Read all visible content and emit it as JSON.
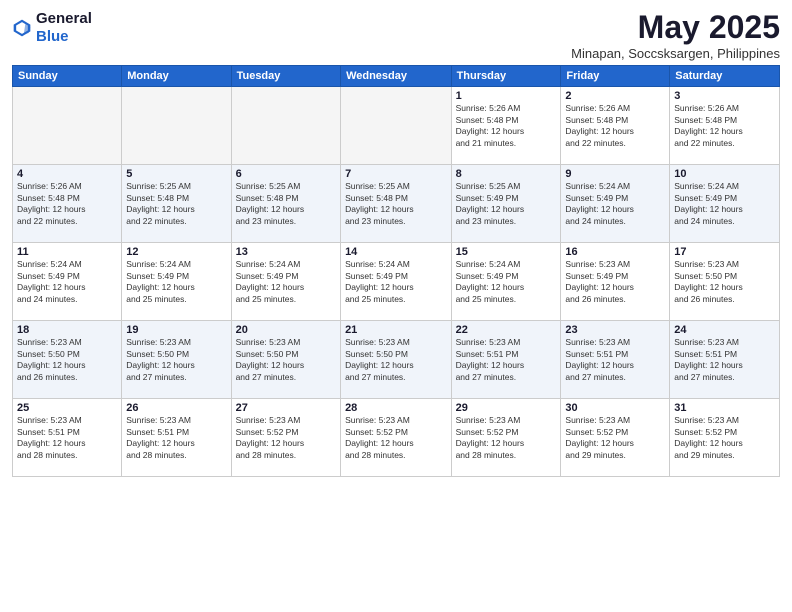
{
  "logo": {
    "general": "General",
    "blue": "Blue"
  },
  "title": "May 2025",
  "location": "Minapan, Soccsksargen, Philippines",
  "days_of_week": [
    "Sunday",
    "Monday",
    "Tuesday",
    "Wednesday",
    "Thursday",
    "Friday",
    "Saturday"
  ],
  "weeks": [
    [
      {
        "num": "",
        "info": ""
      },
      {
        "num": "",
        "info": ""
      },
      {
        "num": "",
        "info": ""
      },
      {
        "num": "",
        "info": ""
      },
      {
        "num": "1",
        "info": "Sunrise: 5:26 AM\nSunset: 5:48 PM\nDaylight: 12 hours\nand 21 minutes."
      },
      {
        "num": "2",
        "info": "Sunrise: 5:26 AM\nSunset: 5:48 PM\nDaylight: 12 hours\nand 22 minutes."
      },
      {
        "num": "3",
        "info": "Sunrise: 5:26 AM\nSunset: 5:48 PM\nDaylight: 12 hours\nand 22 minutes."
      }
    ],
    [
      {
        "num": "4",
        "info": "Sunrise: 5:26 AM\nSunset: 5:48 PM\nDaylight: 12 hours\nand 22 minutes."
      },
      {
        "num": "5",
        "info": "Sunrise: 5:25 AM\nSunset: 5:48 PM\nDaylight: 12 hours\nand 22 minutes."
      },
      {
        "num": "6",
        "info": "Sunrise: 5:25 AM\nSunset: 5:48 PM\nDaylight: 12 hours\nand 23 minutes."
      },
      {
        "num": "7",
        "info": "Sunrise: 5:25 AM\nSunset: 5:48 PM\nDaylight: 12 hours\nand 23 minutes."
      },
      {
        "num": "8",
        "info": "Sunrise: 5:25 AM\nSunset: 5:49 PM\nDaylight: 12 hours\nand 23 minutes."
      },
      {
        "num": "9",
        "info": "Sunrise: 5:24 AM\nSunset: 5:49 PM\nDaylight: 12 hours\nand 24 minutes."
      },
      {
        "num": "10",
        "info": "Sunrise: 5:24 AM\nSunset: 5:49 PM\nDaylight: 12 hours\nand 24 minutes."
      }
    ],
    [
      {
        "num": "11",
        "info": "Sunrise: 5:24 AM\nSunset: 5:49 PM\nDaylight: 12 hours\nand 24 minutes."
      },
      {
        "num": "12",
        "info": "Sunrise: 5:24 AM\nSunset: 5:49 PM\nDaylight: 12 hours\nand 25 minutes."
      },
      {
        "num": "13",
        "info": "Sunrise: 5:24 AM\nSunset: 5:49 PM\nDaylight: 12 hours\nand 25 minutes."
      },
      {
        "num": "14",
        "info": "Sunrise: 5:24 AM\nSunset: 5:49 PM\nDaylight: 12 hours\nand 25 minutes."
      },
      {
        "num": "15",
        "info": "Sunrise: 5:24 AM\nSunset: 5:49 PM\nDaylight: 12 hours\nand 25 minutes."
      },
      {
        "num": "16",
        "info": "Sunrise: 5:23 AM\nSunset: 5:49 PM\nDaylight: 12 hours\nand 26 minutes."
      },
      {
        "num": "17",
        "info": "Sunrise: 5:23 AM\nSunset: 5:50 PM\nDaylight: 12 hours\nand 26 minutes."
      }
    ],
    [
      {
        "num": "18",
        "info": "Sunrise: 5:23 AM\nSunset: 5:50 PM\nDaylight: 12 hours\nand 26 minutes."
      },
      {
        "num": "19",
        "info": "Sunrise: 5:23 AM\nSunset: 5:50 PM\nDaylight: 12 hours\nand 27 minutes."
      },
      {
        "num": "20",
        "info": "Sunrise: 5:23 AM\nSunset: 5:50 PM\nDaylight: 12 hours\nand 27 minutes."
      },
      {
        "num": "21",
        "info": "Sunrise: 5:23 AM\nSunset: 5:50 PM\nDaylight: 12 hours\nand 27 minutes."
      },
      {
        "num": "22",
        "info": "Sunrise: 5:23 AM\nSunset: 5:51 PM\nDaylight: 12 hours\nand 27 minutes."
      },
      {
        "num": "23",
        "info": "Sunrise: 5:23 AM\nSunset: 5:51 PM\nDaylight: 12 hours\nand 27 minutes."
      },
      {
        "num": "24",
        "info": "Sunrise: 5:23 AM\nSunset: 5:51 PM\nDaylight: 12 hours\nand 27 minutes."
      }
    ],
    [
      {
        "num": "25",
        "info": "Sunrise: 5:23 AM\nSunset: 5:51 PM\nDaylight: 12 hours\nand 28 minutes."
      },
      {
        "num": "26",
        "info": "Sunrise: 5:23 AM\nSunset: 5:51 PM\nDaylight: 12 hours\nand 28 minutes."
      },
      {
        "num": "27",
        "info": "Sunrise: 5:23 AM\nSunset: 5:52 PM\nDaylight: 12 hours\nand 28 minutes."
      },
      {
        "num": "28",
        "info": "Sunrise: 5:23 AM\nSunset: 5:52 PM\nDaylight: 12 hours\nand 28 minutes."
      },
      {
        "num": "29",
        "info": "Sunrise: 5:23 AM\nSunset: 5:52 PM\nDaylight: 12 hours\nand 28 minutes."
      },
      {
        "num": "30",
        "info": "Sunrise: 5:23 AM\nSunset: 5:52 PM\nDaylight: 12 hours\nand 29 minutes."
      },
      {
        "num": "31",
        "info": "Sunrise: 5:23 AM\nSunset: 5:52 PM\nDaylight: 12 hours\nand 29 minutes."
      }
    ]
  ]
}
